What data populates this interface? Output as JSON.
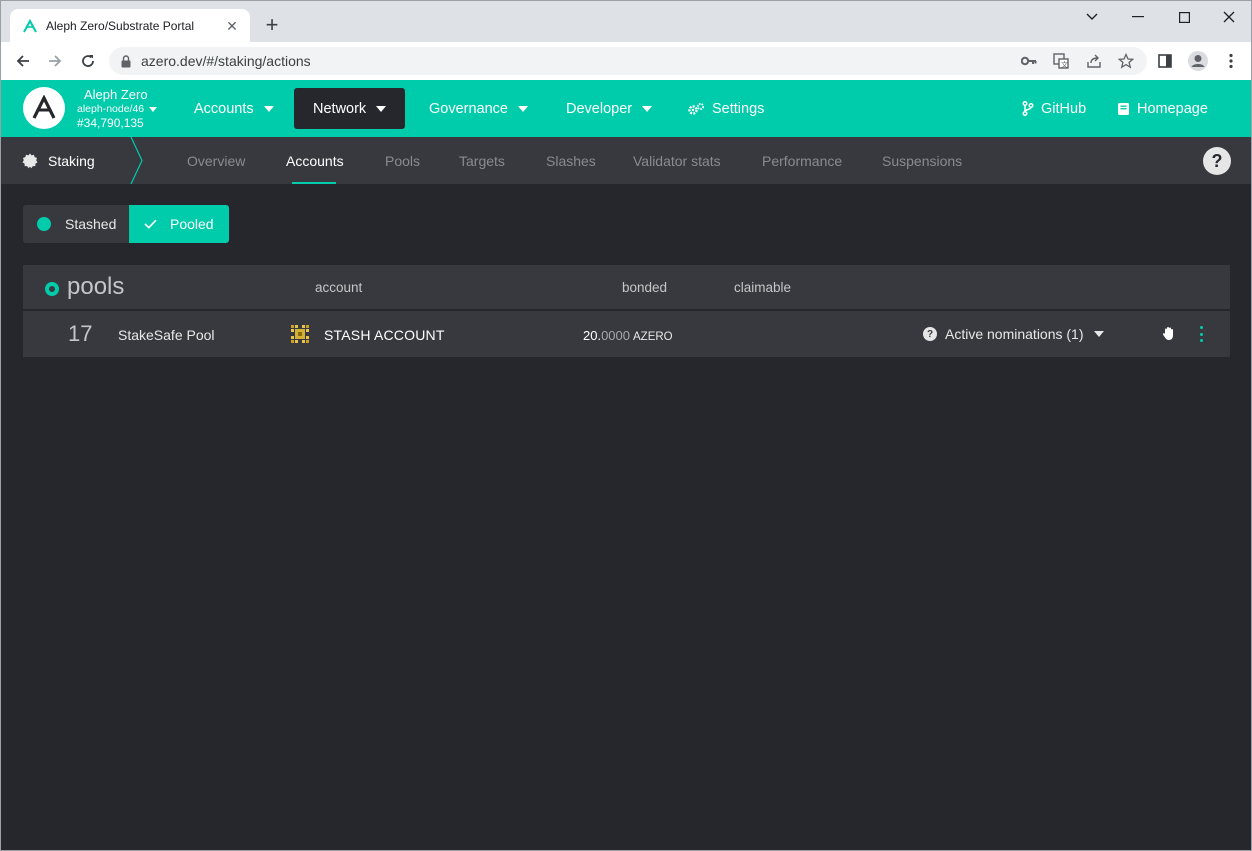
{
  "browser": {
    "tab_title": "Aleph Zero/Substrate Portal",
    "url": "azero.dev/#/staking/actions"
  },
  "chain": {
    "name": "Aleph Zero",
    "node": "aleph-node/46",
    "block": "#34,790,135"
  },
  "menu": {
    "accounts": "Accounts",
    "network": "Network",
    "governance": "Governance",
    "developer": "Developer",
    "settings": "Settings",
    "github": "GitHub",
    "homepage": "Homepage"
  },
  "subnav": {
    "title": "Staking",
    "tabs": [
      "Overview",
      "Accounts",
      "Pools",
      "Targets",
      "Slashes",
      "Validator stats",
      "Performance",
      "Suspensions"
    ],
    "active_tab": "Accounts",
    "help": "?"
  },
  "toggle": {
    "stashed": "Stashed",
    "pooled": "Pooled",
    "selected": "Pooled"
  },
  "pools_table": {
    "title": "pools",
    "columns": [
      "account",
      "bonded",
      "claimable"
    ],
    "rows": [
      {
        "id": "17",
        "name": "StakeSafe Pool",
        "account": "STASH ACCOUNT",
        "bonded_int": "20.",
        "bonded_frac": "0000",
        "bonded_unit": "AZERO",
        "nominations": "Active nominations (1)"
      }
    ]
  },
  "colors": {
    "accent": "#00ccab",
    "background": "#26272c",
    "panel": "#38393f"
  }
}
